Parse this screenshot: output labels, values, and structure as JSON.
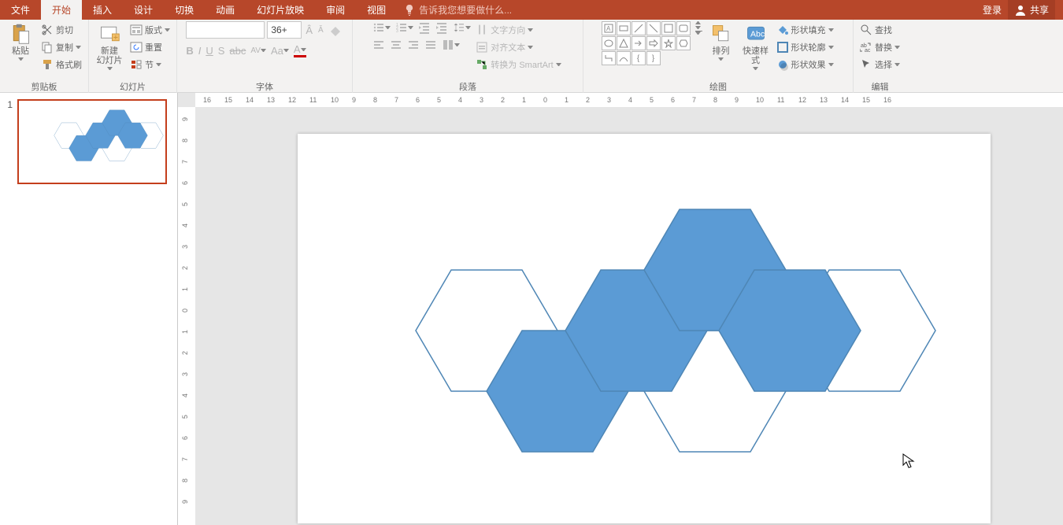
{
  "tabs": {
    "file": "文件",
    "home": "开始",
    "insert": "插入",
    "design": "设计",
    "transition": "切换",
    "animation": "动画",
    "slideshow": "幻灯片放映",
    "review": "审阅",
    "view": "视图"
  },
  "tell_me": "告诉我您想要做什么...",
  "login": "登录",
  "share": "共享",
  "groups": {
    "clipboard": {
      "label": "剪贴板",
      "paste": "粘贴",
      "cut": "剪切",
      "copy": "复制",
      "format_painter": "格式刷"
    },
    "slides": {
      "label": "幻灯片",
      "new_slide": "新建\n幻灯片",
      "layout": "版式",
      "reset": "重置",
      "section": "节"
    },
    "font": {
      "label": "字体",
      "size": "36+"
    },
    "paragraph": {
      "label": "段落",
      "text_direction": "文字方向",
      "align_text": "对齐文本",
      "convert_smartart": "转换为 SmartArt"
    },
    "drawing": {
      "label": "绘图",
      "arrange": "排列",
      "quick_styles": "快速样式",
      "shape_fill": "形状填充",
      "shape_outline": "形状轮廓",
      "shape_effects": "形状效果"
    },
    "editing": {
      "label": "编辑",
      "find": "查找",
      "replace": "替换",
      "select": "选择"
    }
  },
  "thumbnails": [
    {
      "num": "1"
    }
  ],
  "ruler_h": [
    "16",
    "15",
    "14",
    "13",
    "12",
    "11",
    "10",
    "9",
    "8",
    "7",
    "6",
    "5",
    "4",
    "3",
    "2",
    "1",
    "0",
    "1",
    "2",
    "3",
    "4",
    "5",
    "6",
    "7",
    "8",
    "9",
    "10",
    "11",
    "12",
    "13",
    "14",
    "15",
    "16"
  ],
  "ruler_v": [
    "9",
    "8",
    "7",
    "6",
    "5",
    "4",
    "3",
    "2",
    "1",
    "0",
    "1",
    "2",
    "3",
    "4",
    "5",
    "6",
    "7",
    "8",
    "9"
  ],
  "hex_fill": "#5b9bd5",
  "hex_stroke": "#4e86b5"
}
